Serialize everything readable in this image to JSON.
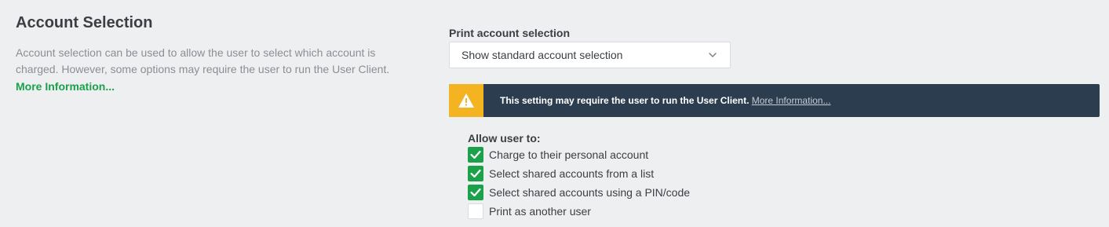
{
  "section": {
    "title": "Account Selection",
    "description": "Account selection can be used to allow the user to select which account is charged. However, some options may require the user to run the User Client.",
    "more_link": "More Information..."
  },
  "print_selection": {
    "label": "Print account selection",
    "value": "Show standard account selection",
    "icon": "chevron-down-icon"
  },
  "warning": {
    "icon": "warning-icon",
    "text": "This setting may require the user to run the User Client.",
    "link": "More Information...",
    "colors": {
      "icon_bg": "#f4b321",
      "bg": "#2b3d4f"
    }
  },
  "allow": {
    "label": "Allow user to:",
    "options": [
      {
        "label": "Charge to their personal account",
        "checked": true
      },
      {
        "label": "Select shared accounts from a list",
        "checked": true
      },
      {
        "label": "Select shared accounts using a PIN/code",
        "checked": true
      },
      {
        "label": "Print as another user",
        "checked": false
      }
    ]
  },
  "colors": {
    "accent": "#1aa14a",
    "background": "#eeeff1"
  }
}
